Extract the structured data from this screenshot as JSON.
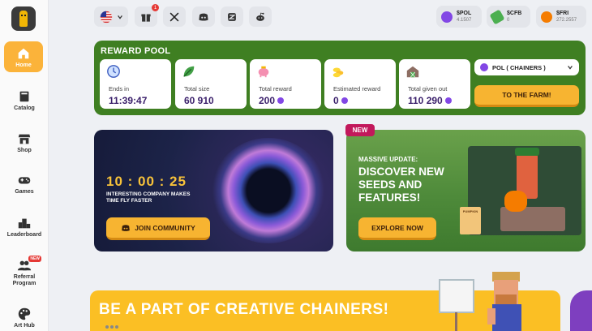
{
  "sidebar": {
    "items": [
      {
        "label": "Home",
        "icon": "home-icon"
      },
      {
        "label": "Catalog",
        "icon": "book-icon"
      },
      {
        "label": "Shop",
        "icon": "shop-icon"
      },
      {
        "label": "Games",
        "icon": "gamepad-icon"
      },
      {
        "label": "Leaderboard",
        "icon": "podium-icon"
      },
      {
        "label": "Referral Program",
        "icon": "users-icon",
        "badge": "NEW"
      },
      {
        "label": "Art Hub",
        "icon": "palette-icon"
      }
    ]
  },
  "topbar": {
    "gift_count": "1",
    "wallets": [
      {
        "symbol": "$POL",
        "amount": "4.1507",
        "color": "#8247e5"
      },
      {
        "symbol": "$CFB",
        "amount": "0",
        "color": "#4caf50"
      },
      {
        "symbol": "$FRI",
        "amount": "272.2557",
        "color": "#f57c00"
      }
    ]
  },
  "reward_pool": {
    "title": "REWARD POOL",
    "cards": [
      {
        "label": "Ends in",
        "value": "11:39:47",
        "icon": "clock-icon"
      },
      {
        "label": "Total size",
        "value": "60 910",
        "icon": "leaf-icon"
      },
      {
        "label": "Total reward",
        "value": "200",
        "icon": "pig-icon",
        "token": true
      },
      {
        "label": "Estimated reward",
        "value": "0",
        "icon": "coins-icon",
        "token": true
      },
      {
        "label": "Total given out",
        "value": "110 290",
        "icon": "barn-icon",
        "token": true
      }
    ],
    "select_value": "POL ( CHAINERS )",
    "farm_button": "TO THE FARM!"
  },
  "community_banner": {
    "timer": "10 : 00 : 25",
    "tagline": "INTERESTING COMPANY MAKES TIME FLY FASTER",
    "button": "JOIN COMMUNITY"
  },
  "update_banner": {
    "tag": "NEW",
    "subtitle": "MASSIVE UPDATE:",
    "headline": "DISCOVER NEW SEEDS AND FEATURES!",
    "button": "EXPLORE NOW",
    "seed_label": "PUMPKIN"
  },
  "creative_banner": {
    "headline": "BE A PART OF CREATIVE CHAINERS!"
  },
  "colors": {
    "accent": "#f7b431",
    "pool_green": "#3f7f22",
    "token_purple": "#8247e5"
  }
}
